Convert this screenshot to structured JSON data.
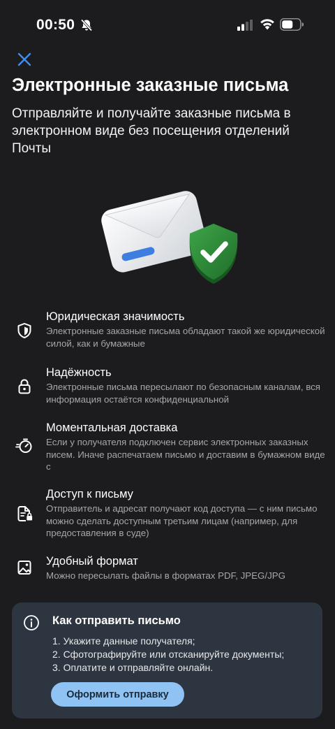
{
  "status_bar": {
    "time": "00:50",
    "icons": [
      "bell-slash-icon",
      "signal-icon",
      "wifi-icon",
      "battery-icon"
    ]
  },
  "header": {
    "close_icon": "close-icon",
    "title": "Электронные заказные письма",
    "subtitle": "Отправляйте и получайте заказные письма в электронном виде без посещения отделений Почты"
  },
  "hero": {
    "image": "envelope-with-shield-check-icon"
  },
  "features": [
    {
      "icon": "shield-half-icon",
      "title": "Юридическая значимость",
      "description": "Электронные заказные письма обладают такой же юридической силой, как и бумажные"
    },
    {
      "icon": "padlock-icon",
      "title": "Надёжность",
      "description": "Электронные письма пересылают по безопасным каналам, вся информация остаётся конфиденциальной"
    },
    {
      "icon": "stopwatch-icon",
      "title": "Моментальная доставка",
      "description": "Если у получателя подключен сервис электронных заказных писем. Иначе распечатаем письмо и доставим в бумажном виде с"
    },
    {
      "icon": "document-lock-icon",
      "title": "Доступ к письму",
      "description": "Отправитель и адресат получают код доступа — с ним письмо можно сделать доступным третьим лицам (например, для предоставления в суде)"
    },
    {
      "icon": "image-file-icon",
      "title": "Удобный формат",
      "description": "Можно пересылать файлы в форматах PDF, JPEG/JPG"
    }
  ],
  "how_to": {
    "icon": "info-icon",
    "title": "Как отправить письмо",
    "steps": [
      "1. Укажите данные получателя;",
      "2. Сфотографируйте или отсканируйте документы;",
      "3. Оплатите и отправляйте онлайн."
    ],
    "button_label": "Оформить отправку"
  },
  "colors": {
    "background": "#1c1c1e",
    "card": "#2c3540",
    "accent": "#8ec3f3",
    "close": "#3d8ff0",
    "secondary_text": "#a6a6ab",
    "shield_green": "#2f8f3a"
  }
}
